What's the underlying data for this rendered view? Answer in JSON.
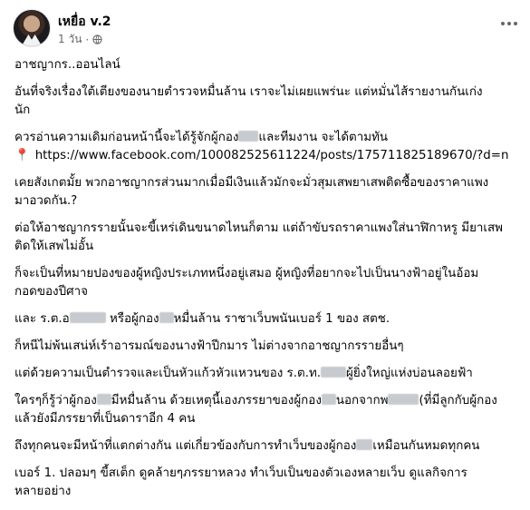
{
  "post": {
    "author": "เหยื่อ v.2",
    "time": "1 วัน",
    "dot": "·"
  },
  "lines": [
    [
      "อาชญากร..ออนไลน์"
    ],
    [
      "อันที่จริงเรื่องใต้เตียงของนายตำรวจหมื่นล้าน เราจะไม่เผยแพร่นะ แต่หมั่นไส้รายงานกันเก่ง",
      "นัก"
    ],
    [
      "ควรอ่านความเดิมก่อนหน้านี้จะได้รู้จักผู้กอง",
      "และทีมงาน จะได้ตามทัน"
    ],
    [
      "https://www.facebook.com/100082525611224/posts/175711825189670/?d=n"
    ],
    [
      "เคยสังเกตมั้ย พวกอาชญากรส่วนมากเมื่อมีเงินแล้วมักจะมั่วสุมเสพยาเสพติดซื้อของราคาแพง",
      "มาอวดกัน.?"
    ],
    [
      "ต่อให้อาชญากรรายนั้นจะขี้เหร่เดินขนาดไหนก็ตาม แต่ถ้าขับรถราคาแพงใส่นาฬิกาหรู มียาเสพ",
      "ติดให้เสพไม่อั้น"
    ],
    [
      "ก็จะเป็นที่หมายปองของผู้หญิงประเภทหนึ่งอยู่เสมอ ผู้หญิงที่อยากจะไปเป็นนางฟ้าอยู่ในอ้อม",
      "กอดของปีศาจ"
    ],
    [
      "และ ร.ต.อ",
      "หรือผู้กอง",
      "หมื่นล้าน ราชาเว็บพนันเบอร์ 1 ของ สตช."
    ],
    [
      "ก็หนีไม่พ้นเสน่ห์เร้าอารมณ์ของนางฟ้าปีกมาร ไม่ต่างจากอาชญากรรายอื่นๆ"
    ],
    [
      "แต่ด้วยความเป็นตำรวจและเป็นหัวแก้วหัวแหวนของ ร.ต.ท.",
      "ผู้ยิ่งใหญ่แห่งบ่อนลอยฟ้า"
    ],
    [
      "ใครๆก็รู้ว่าผู้กอง",
      "มีหมื่นล้าน ด้วยเหตุนี้เองภรรยาของผู้กอง",
      "นอกจากพ",
      "(ที่มีลูกกับผู้กอง",
      "แล้วยังมีภรรยาที่เป็นดาราอีก 4 คน"
    ],
    [
      "ถึงทุกคนจะมีหน้าที่แตกต่างกัน แต่เกี่ยวข้องกับการทำเว็บของผู้กอง",
      "เหมือนกันหมดทุกคน"
    ],
    [
      "เบอร์ 1. ปลอมๆ ขี้สเต็ก ดูคล้ายๆภรรยาหลวง ทำเว็บเป็นของตัวเองหลายเว็บ ดูแลกิจการ",
      "หลายอย่าง"
    ]
  ],
  "colors": {
    "text": "#050505",
    "secondary": "#65676b",
    "redaction": "#c7cacf",
    "pin": "#e41e3f"
  },
  "icons": {
    "privacy": "globe-icon",
    "menu": "more-horizontal-icon",
    "pin": "pushpin-icon"
  }
}
